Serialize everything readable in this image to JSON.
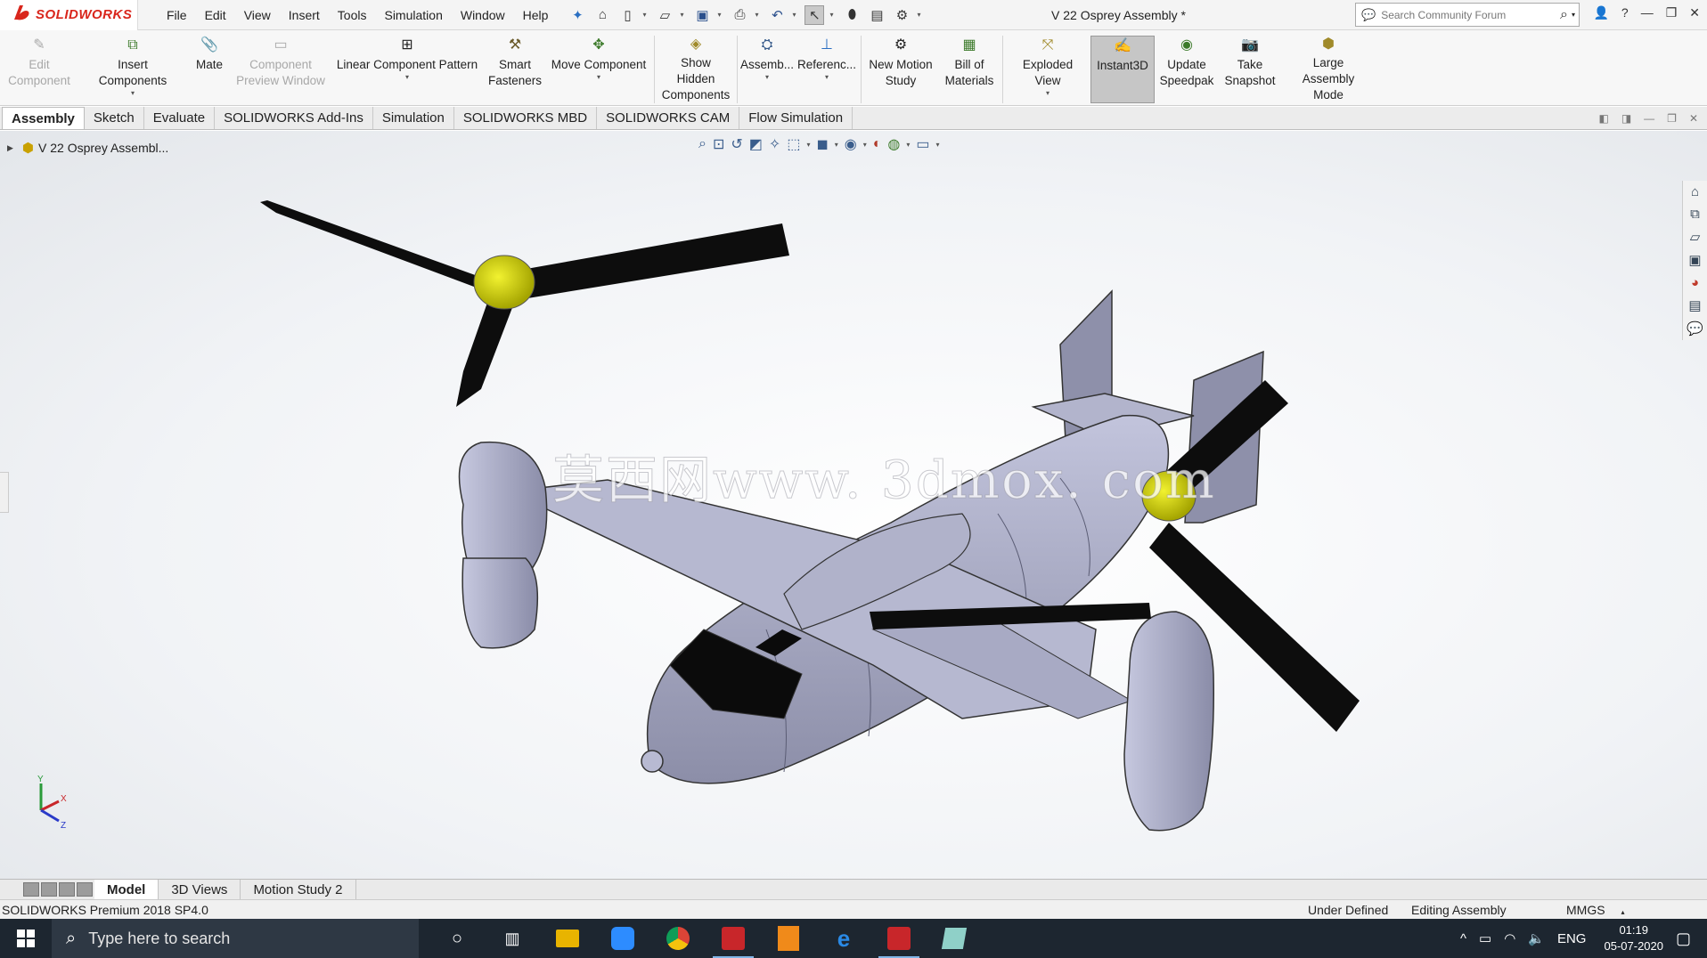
{
  "app": {
    "brand_prefix": "3S",
    "brand": "SOLIDWORKS",
    "document_title": "V 22 Osprey Assembly *"
  },
  "menu": [
    "File",
    "Edit",
    "View",
    "Insert",
    "Tools",
    "Simulation",
    "Window",
    "Help"
  ],
  "search": {
    "placeholder": "Search Community Forum"
  },
  "ribbon": {
    "edit_component": "Edit Component",
    "insert_components": "Insert Components",
    "mate": "Mate",
    "component_preview": "Component Preview Window",
    "linear_pattern": "Linear Component Pattern",
    "smart_fasteners": "Smart Fasteners",
    "move_component": "Move Component",
    "show_hidden": "Show Hidden Components",
    "assembly_features": "Assemb...",
    "reference_geometry": "Referenc...",
    "new_motion_study": "New Motion Study",
    "bill_of_materials": "Bill of Materials",
    "exploded_view": "Exploded View",
    "instant3d": "Instant3D",
    "update_speedpak": "Update Speedpak",
    "take_snapshot": "Take Snapshot",
    "large_assembly_mode": "Large Assembly Mode"
  },
  "tabs": [
    "Assembly",
    "Sketch",
    "Evaluate",
    "SOLIDWORKS Add-Ins",
    "Simulation",
    "SOLIDWORKS MBD",
    "SOLIDWORKS CAM",
    "Flow Simulation"
  ],
  "tree": {
    "root": "V 22 Osprey Assembl..."
  },
  "watermark": "莫西网www. 3dmox. com",
  "triad": {
    "y": "Y",
    "x": "X",
    "z": "Z"
  },
  "model_tabs": [
    "Model",
    "3D Views",
    "Motion Study 2"
  ],
  "status": {
    "product": "SOLIDWORKS Premium 2018 SP4.0",
    "definition": "Under Defined",
    "mode": "Editing Assembly",
    "units": "MMGS"
  },
  "taskbar": {
    "search_placeholder": "Type here to search",
    "language": "ENG",
    "time": "01:19",
    "date": "05-07-2020"
  },
  "colors": {
    "accent": "#d9261c",
    "fuselage": "#a4a6c2",
    "rotor_hub": "#d4d400",
    "blades": "#0d0d0d",
    "taskbar": "#1d2630"
  }
}
